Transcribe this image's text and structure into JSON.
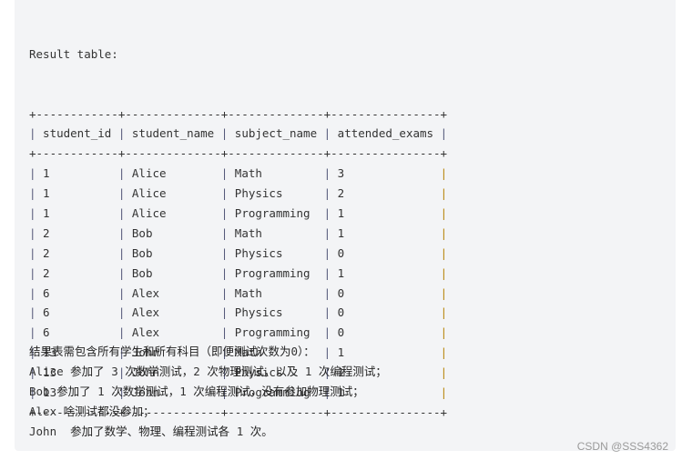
{
  "caption": "Result table:",
  "table": {
    "columns": [
      "student_id",
      "student_name",
      "subject_name",
      "attended_exams"
    ],
    "widths": [
      12,
      14,
      14,
      16
    ],
    "rows": [
      [
        "1",
        "Alice",
        "Math",
        "3"
      ],
      [
        "1",
        "Alice",
        "Physics",
        "2"
      ],
      [
        "1",
        "Alice",
        "Programming",
        "1"
      ],
      [
        "2",
        "Bob",
        "Math",
        "1"
      ],
      [
        "2",
        "Bob",
        "Physics",
        "0"
      ],
      [
        "2",
        "Bob",
        "Programming",
        "1"
      ],
      [
        "6",
        "Alex",
        "Math",
        "0"
      ],
      [
        "6",
        "Alex",
        "Physics",
        "0"
      ],
      [
        "6",
        "Alex",
        "Programming",
        "0"
      ],
      [
        "13",
        "John",
        "Math",
        "1"
      ],
      [
        "13",
        "John",
        "Physics",
        "1"
      ],
      [
        "13",
        "John",
        "Programming",
        "1"
      ]
    ]
  },
  "notes": [
    "结果表需包含所有学生和所有科目（即便测试次数为0）：",
    "Alice 参加了 3 次数学测试，2 次物理测试，以及 1 次编程测试；",
    "Bob 参加了 1 次数学测试，1 次编程测试，没有参加物理测试；",
    "Alex 啥测试都没参加；",
    "John  参加了数学、物理、编程测试各 1 次。"
  ],
  "watermark": "CSDN @SSS4362"
}
